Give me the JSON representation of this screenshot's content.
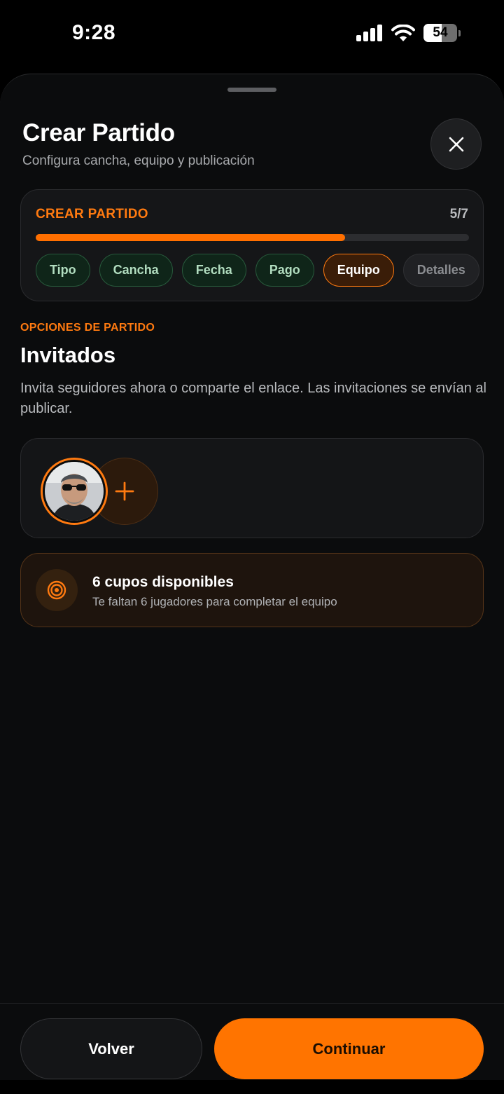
{
  "status_bar": {
    "time": "9:28",
    "battery_level": "54",
    "battery_fraction": 0.54
  },
  "sheet": {
    "title": "Crear Partido",
    "subtitle": "Configura cancha, equipo y publicación",
    "close_icon": "close-icon"
  },
  "progress": {
    "label": "CREAR PARTIDO",
    "count": "5/7",
    "fraction": 0.714,
    "steps": [
      {
        "label": "Tipo",
        "state": "done"
      },
      {
        "label": "Cancha",
        "state": "done"
      },
      {
        "label": "Fecha",
        "state": "done"
      },
      {
        "label": "Pago",
        "state": "done"
      },
      {
        "label": "Equipo",
        "state": "current"
      },
      {
        "label": "Detalles",
        "state": "pending"
      }
    ]
  },
  "section": {
    "eyebrow": "OPCIONES DE PARTIDO",
    "title": "Invitados",
    "description": "Invita seguidores ahora o comparte el enlace. Las invitaciones se envían al publicar."
  },
  "invite": {
    "add_icon": "plus-icon"
  },
  "slots": {
    "title": "6 cupos disponibles",
    "subtitle": "Te faltan 6 jugadores para completar el equipo",
    "icon": "target-icon"
  },
  "footer": {
    "back_label": "Volver",
    "continue_label": "Continuar"
  },
  "colors": {
    "accent": "#ff7400",
    "step_done": "#285a3c",
    "background": "#0b0c0d"
  }
}
